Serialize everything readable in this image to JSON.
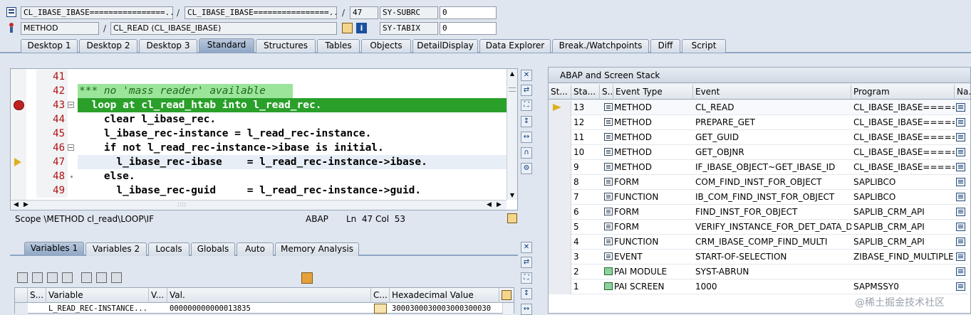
{
  "header": {
    "row1": {
      "class_field": "CL_IBASE_IBASE================...",
      "class_field2": "CL_IBASE_IBASE================...",
      "line_no": "47",
      "sy_label": "SY-SUBRC",
      "sy_value": "0"
    },
    "row2": {
      "type_field": "METHOD",
      "method_field": "CL_READ (CL_IBASE_IBASE)",
      "sy_label": "SY-TABIX",
      "sy_value": "0"
    }
  },
  "tabs": [
    {
      "label": "Desktop 1"
    },
    {
      "label": "Desktop 2"
    },
    {
      "label": "Desktop 3"
    },
    {
      "label": "Standard"
    },
    {
      "label": "Structures"
    },
    {
      "label": "Tables"
    },
    {
      "label": "Objects"
    },
    {
      "label": "DetailDisplay"
    },
    {
      "label": "Data Explorer"
    },
    {
      "label": "Break./Watchpoints"
    },
    {
      "label": "Diff"
    },
    {
      "label": "Script"
    }
  ],
  "editor": {
    "lines": [
      {
        "no": "41",
        "text": ""
      },
      {
        "no": "42",
        "text": "*** no 'mass reader' available"
      },
      {
        "no": "43",
        "text": "  loop at cl_read_htab into l_read_rec."
      },
      {
        "no": "44",
        "text": "    clear l_ibase_rec."
      },
      {
        "no": "45",
        "text": "    l_ibase_rec-instance = l_read_rec-instance."
      },
      {
        "no": "46",
        "text": "    if not l_read_rec-instance->ibase is initial."
      },
      {
        "no": "47",
        "text": "      l_ibase_rec-ibase    = l_read_rec-instance->ibase."
      },
      {
        "no": "48",
        "text": "    else."
      },
      {
        "no": "49",
        "text": "      l_ibase_rec-guid     = l_read_rec-instance->guid."
      }
    ],
    "status": {
      "scope": "Scope \\METHOD cl_read\\LOOP\\IF",
      "lang": "ABAP",
      "pos": "Ln  47 Col  53"
    }
  },
  "vars_tabs": [
    {
      "label": "Variables 1"
    },
    {
      "label": "Variables 2"
    },
    {
      "label": "Locals"
    },
    {
      "label": "Globals"
    },
    {
      "label": "Auto"
    },
    {
      "label": "Memory Analysis"
    }
  ],
  "vars_table": {
    "headers": [
      "S...",
      "Variable",
      "V...",
      "Val.",
      "C...",
      "Hexadecimal Value"
    ],
    "rows": [
      {
        "variable": "L_READ_REC-INSTANCE...",
        "value": "000000000000013835",
        "hex": "3000300030003000300030"
      }
    ]
  },
  "stack": {
    "title": "ABAP and Screen Stack",
    "headers": [
      "St...",
      "Sta...",
      "S...",
      "Event Type",
      "Event",
      "Program",
      "Na..."
    ],
    "rows": [
      {
        "sta": "13",
        "type": "METHOD",
        "event": "CL_READ",
        "program": "CL_IBASE_IBASE======...",
        "icon": "method",
        "current": true
      },
      {
        "sta": "12",
        "type": "METHOD",
        "event": "PREPARE_GET",
        "program": "CL_IBASE_IBASE======...",
        "icon": "method"
      },
      {
        "sta": "11",
        "type": "METHOD",
        "event": "GET_GUID",
        "program": "CL_IBASE_IBASE======...",
        "icon": "method"
      },
      {
        "sta": "10",
        "type": "METHOD",
        "event": "GET_OBJNR",
        "program": "CL_IBASE_IBASE======...",
        "icon": "method"
      },
      {
        "sta": "9",
        "type": "METHOD",
        "event": "IF_IBASE_OBJECT~GET_IBASE_ID",
        "program": "CL_IBASE_IBASE======...",
        "icon": "method"
      },
      {
        "sta": "8",
        "type": "FORM",
        "event": "COM_FIND_INST_FOR_OBJECT",
        "program": "SAPLIBCO",
        "icon": "method"
      },
      {
        "sta": "7",
        "type": "FUNCTION",
        "event": "IB_COM_FIND_INST_FOR_OBJECT",
        "program": "SAPLIBCO",
        "icon": "method"
      },
      {
        "sta": "6",
        "type": "FORM",
        "event": "FIND_INST_FOR_OBJECT",
        "program": "SAPLIB_CRM_API",
        "icon": "method"
      },
      {
        "sta": "5",
        "type": "FORM",
        "event": "VERIFY_INSTANCE_FOR_DET_DATA_D",
        "program": "SAPLIB_CRM_API",
        "icon": "method"
      },
      {
        "sta": "4",
        "type": "FUNCTION",
        "event": "CRM_IBASE_COMP_FIND_MULTI",
        "program": "SAPLIB_CRM_API",
        "icon": "method"
      },
      {
        "sta": "3",
        "type": "EVENT",
        "event": "START-OF-SELECTION",
        "program": "ZIBASE_FIND_MULTIPLE",
        "icon": "method"
      },
      {
        "sta": "2",
        "type": "PAI MODULE",
        "event": "SYST-ABRUN",
        "program": "",
        "icon": "screen"
      },
      {
        "sta": "1",
        "type": "PAI SCREEN",
        "event": "1000",
        "program": "SAPMSSY0",
        "icon": "screen"
      }
    ]
  },
  "watermark": "@稀土掘金技术社区"
}
